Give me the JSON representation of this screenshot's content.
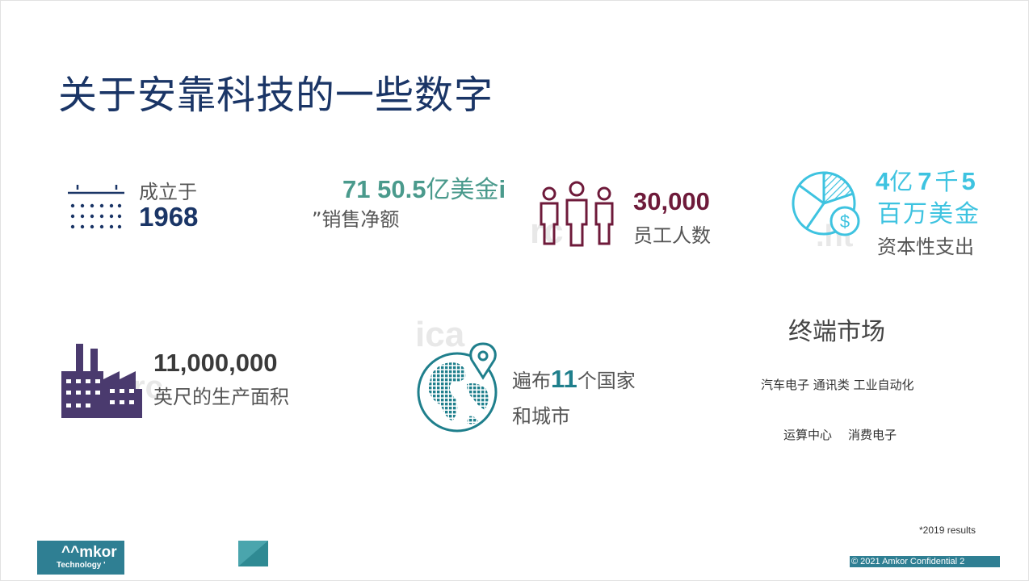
{
  "title": "关于安靠科技的一些数字",
  "founded": {
    "label": "成立于",
    "year": "1968"
  },
  "sales": {
    "value": "71 50.5",
    "unit": "亿美金",
    "tail": "i",
    "label": "”销售净额"
  },
  "employees": {
    "value": "30,000",
    "label": "员工人数"
  },
  "capex": {
    "line1_a": "4",
    "line1_b": "亿",
    "line1_c": "7",
    "line1_d": "千",
    "line1_e": "5",
    "line2": "百万美金",
    "label": "资本性支出"
  },
  "area": {
    "value": "11,000,000",
    "label": "英尺的生产面积"
  },
  "global": {
    "prefix": "遍布",
    "count": "11",
    "suffix": "个国家",
    "line2": "和城市"
  },
  "markets": {
    "heading": "终端市场",
    "row1": "汽车电子 通讯类 工业自动化",
    "row2a": "运算中心",
    "row2b": "消费电子"
  },
  "footnote": "*2019 results",
  "logo": {
    "name": "^^mkor",
    "sub": "Technology '"
  },
  "copyright": "© 2021 Amkor Confidential 2",
  "ghost": {
    "g1": "ica",
    "g2": "rc",
    "g3": ".ht"
  },
  "colors": {
    "navy": "#1a3566",
    "teal": "#4a9a8c",
    "maroon": "#6e1a3a",
    "cyan": "#3ec3e0",
    "purple": "#4a3a6e",
    "globe": "#1f7f8c"
  }
}
